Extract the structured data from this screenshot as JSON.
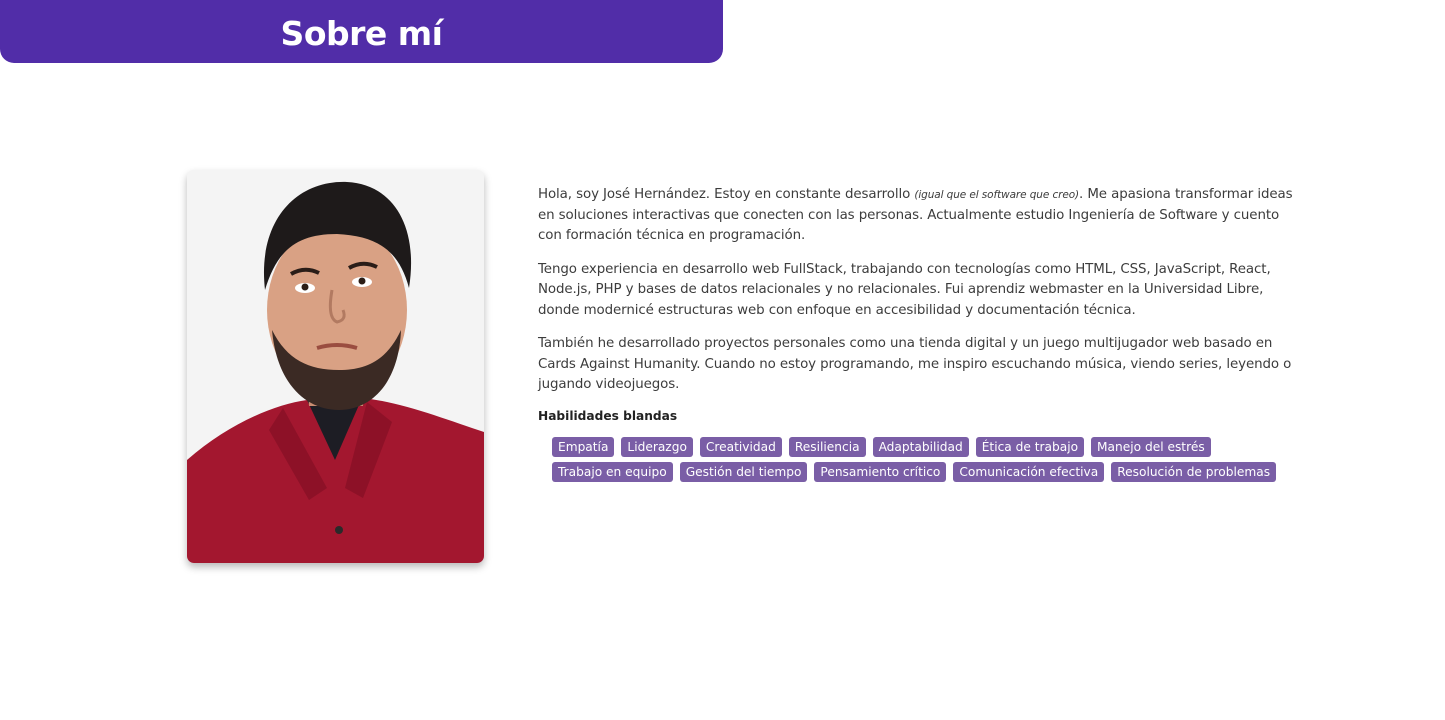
{
  "header": {
    "title": "Sobre mí"
  },
  "profile": {
    "photo_alt": "José Hernández"
  },
  "bio": {
    "p1_a": "Hola, soy José Hernández. Estoy en constante desarrollo ",
    "p1_aside": "(igual que el software que creo)",
    "p1_b": ". Me apasiona transformar ideas en soluciones interactivas que conecten con las personas. Actualmente estudio Ingeniería de Software y cuento con formación técnica en programación.",
    "p2": "Tengo experiencia en desarrollo web FullStack, trabajando con tecnologías como HTML, CSS, JavaScript, React, Node.js, PHP y bases de datos relacionales y no relacionales. Fui aprendiz webmaster en la Universidad Libre, donde modernicé estructuras web con enfoque en accesibilidad y documentación técnica.",
    "p3": "También he desarrollado proyectos personales como una tienda digital y un juego multijugador web basado en Cards Against Humanity. Cuando no estoy programando, me inspiro escuchando música, viendo series, leyendo o jugando videojuegos."
  },
  "skills": {
    "title": "Habilidades blandas",
    "items": [
      "Empatía",
      "Liderazgo",
      "Creatividad",
      "Resiliencia",
      "Adaptabilidad",
      "Ética de trabajo",
      "Manejo del estrés",
      "Trabajo en equipo",
      "Gestión del tiempo",
      "Pensamiento crítico",
      "Comunicación efectiva",
      "Resolución de problemas"
    ]
  },
  "colors": {
    "accent": "#512da8",
    "tag": "#7a5ea6"
  }
}
